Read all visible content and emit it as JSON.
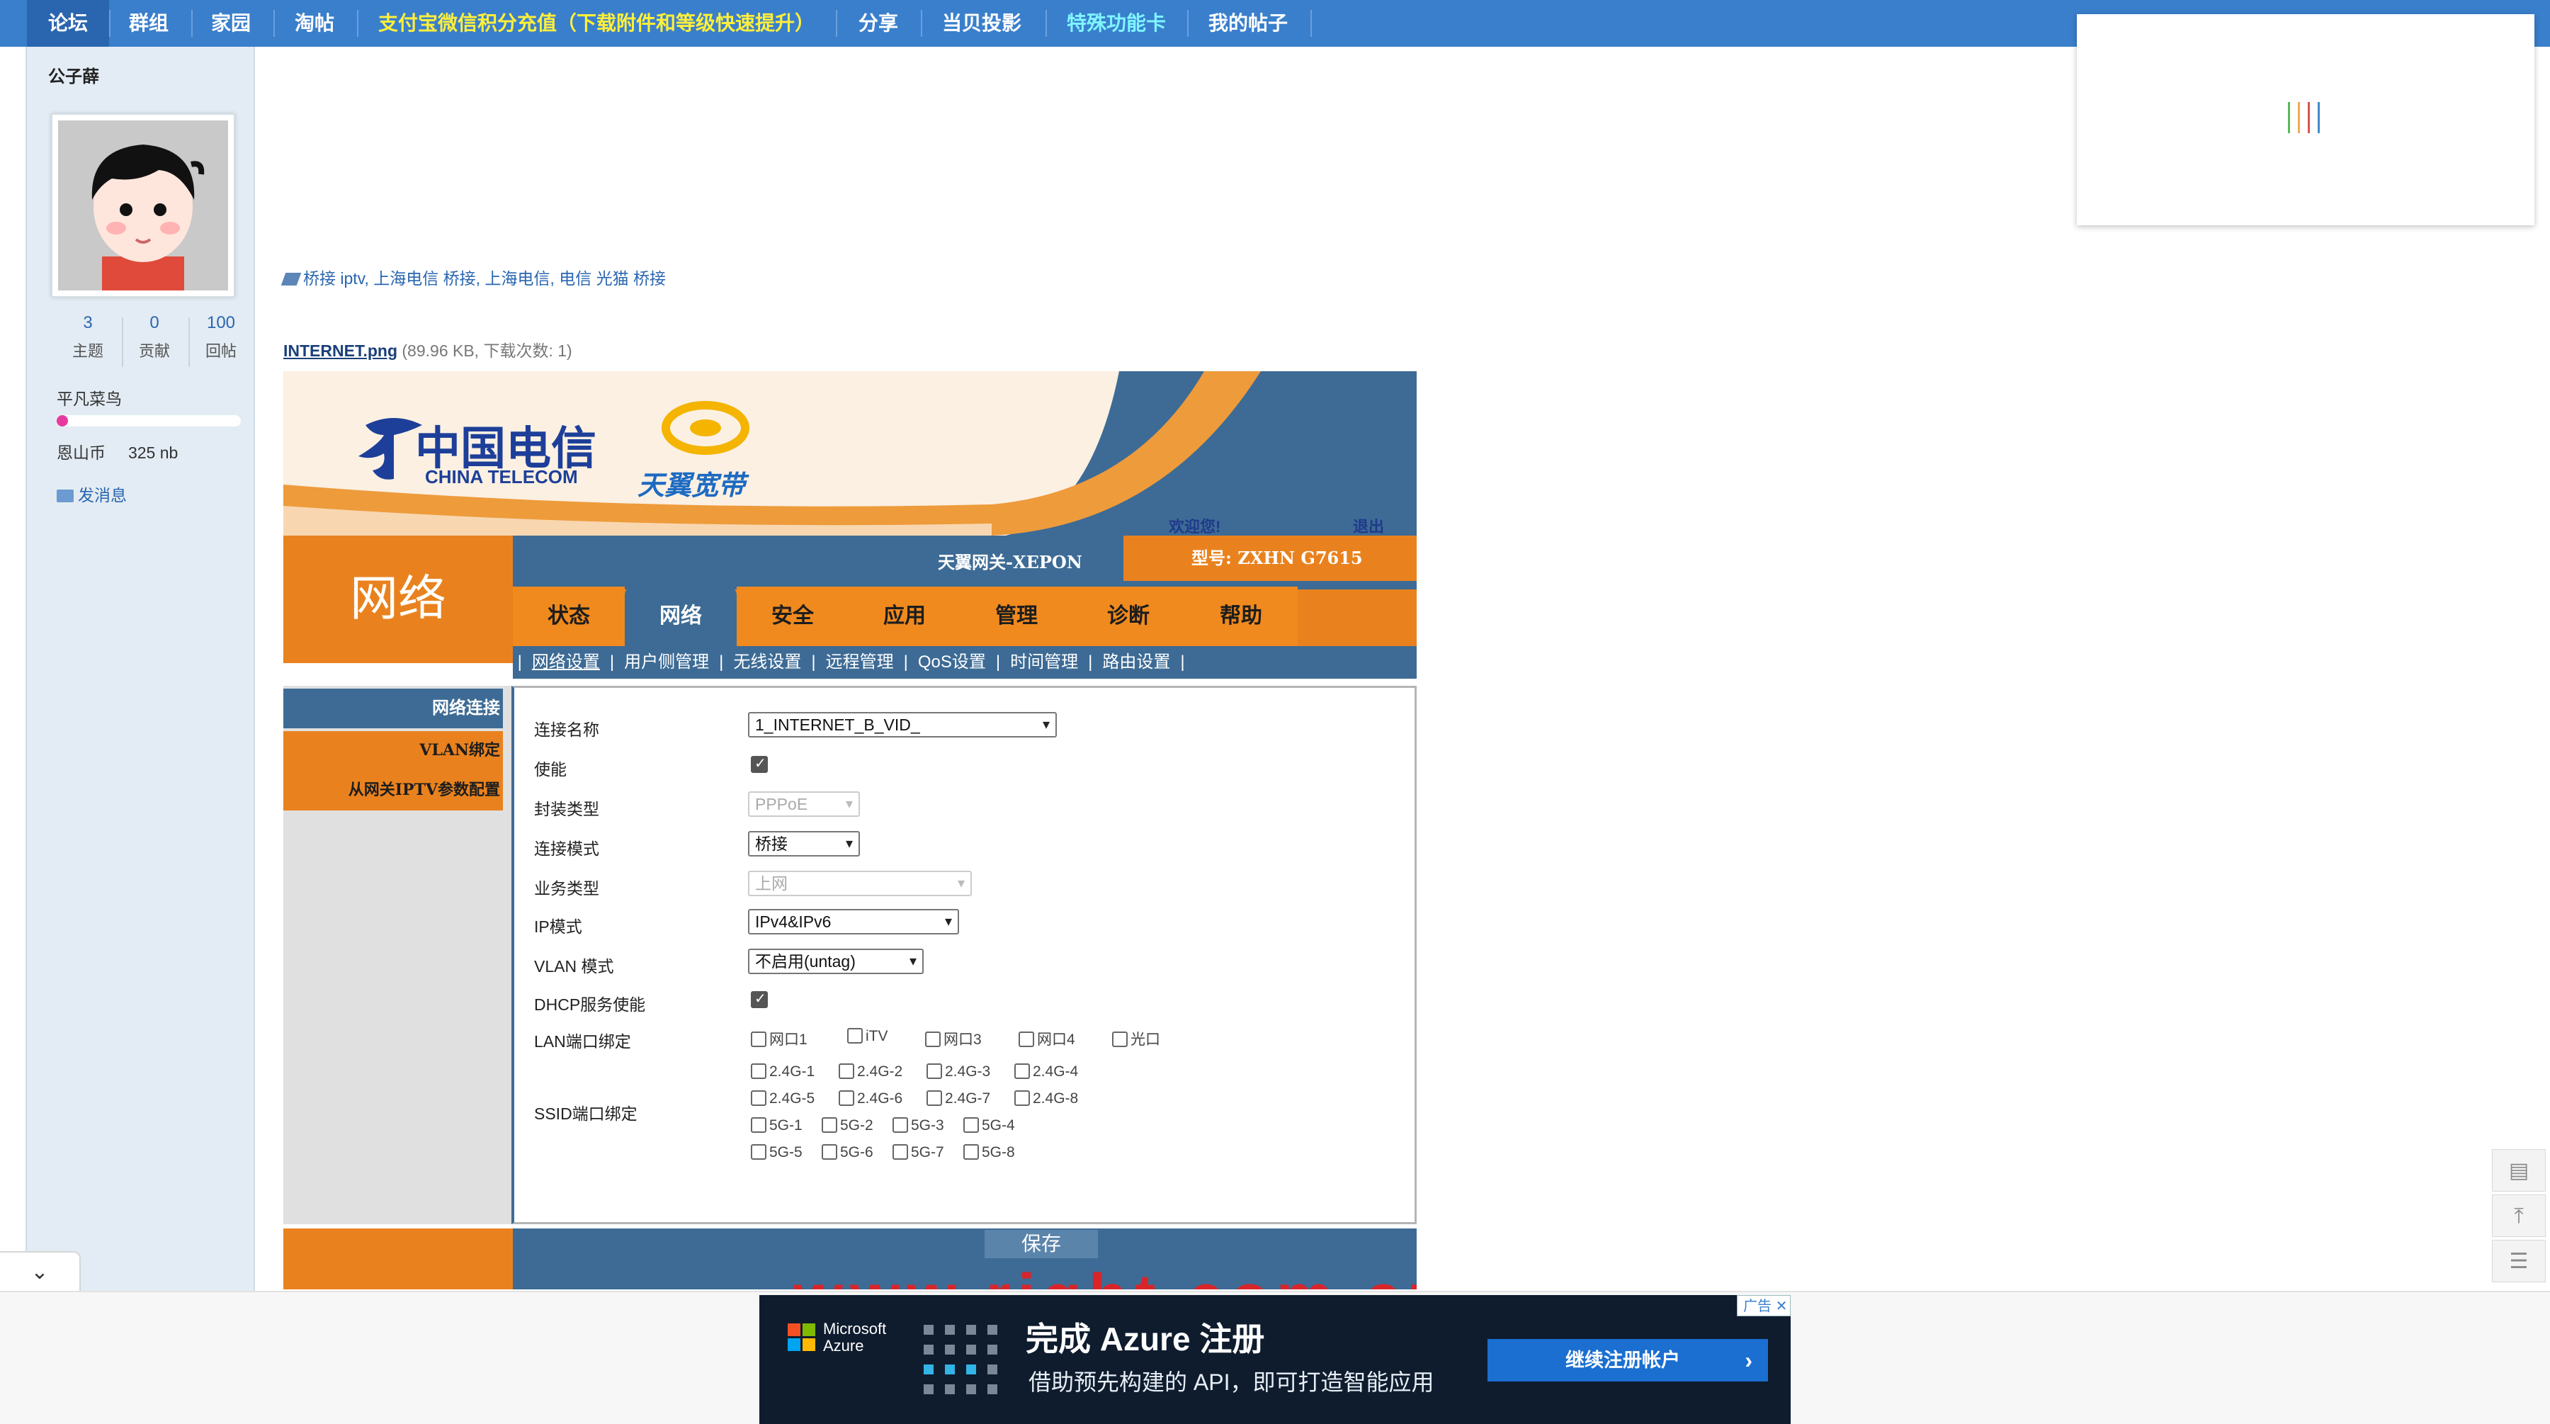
{
  "topnav": {
    "items": [
      "论坛",
      "群组",
      "家园",
      "淘帖",
      "支付宝微信积分充值（下载附件和等级快速提升）",
      "分享",
      "当贝投影",
      "特殊功能卡",
      "我的帖子"
    ]
  },
  "user": {
    "name": "公子薛",
    "stats": [
      {
        "value": "3",
        "label": "主题"
      },
      {
        "value": "0",
        "label": "贡献"
      },
      {
        "value": "100",
        "label": "回帖"
      }
    ],
    "rank": "平凡菜鸟",
    "rank_progress": 0.04,
    "coin_label": "恩山币",
    "coin_value": "325 nb",
    "message_label": "发消息"
  },
  "tags": {
    "items": [
      "桥接 iptv",
      "上海电信 桥接",
      "上海电信",
      "电信 光猫 桥接"
    ]
  },
  "attachment": {
    "name": "INTERNET.png",
    "meta": "(89.96 KB, 下载次数: 1)"
  },
  "router": {
    "brand": "中国电信",
    "brand_en": "CHINA TELECOM",
    "brand2": "天翼宽带",
    "welcome": "欢迎您!",
    "logout": "退出",
    "gateway": "天翼网关-XEPON",
    "model": "型号: ZXHN G7615",
    "page_title": "网络",
    "tabs": [
      "状态",
      "网络",
      "安全",
      "应用",
      "管理",
      "诊断",
      "帮助"
    ],
    "subnav": [
      "网络设置",
      "用户侧管理",
      "无线设置",
      "远程管理",
      "QoS设置",
      "时间管理",
      "路由设置"
    ],
    "left_menu": [
      "网络连接",
      "VLAN绑定",
      "从网关IPTV参数配置"
    ],
    "form": {
      "conn_name_label": "连接名称",
      "conn_name_value": "1_INTERNET_B_VID_",
      "enable_label": "使能",
      "encap_label": "封装类型",
      "encap_value": "PPPoE",
      "mode_label": "连接模式",
      "mode_value": "桥接",
      "service_label": "业务类型",
      "service_value": "上网",
      "ipmode_label": "IP模式",
      "ipmode_value": "IPv4&IPv6",
      "vlan_label": "VLAN 模式",
      "vlan_value": "不启用(untag)",
      "dhcp_label": "DHCP服务使能",
      "lan_label": "LAN端口绑定",
      "lan_ports": [
        "网口1",
        "iTV",
        "网口3",
        "网口4",
        "光口"
      ],
      "ssid_label": "SSID端口绑定",
      "ssid_24": [
        "2.4G-1",
        "2.4G-2",
        "2.4G-3",
        "2.4G-4",
        "2.4G-5",
        "2.4G-6",
        "2.4G-7",
        "2.4G-8"
      ],
      "ssid_5": [
        "5G-1",
        "5G-2",
        "5G-3",
        "5G-4",
        "5G-5",
        "5G-6",
        "5G-7",
        "5G-8"
      ]
    },
    "save_label": "保存",
    "watermark": "www.right.com.cn"
  },
  "ad": {
    "tag": "广告",
    "brand": "Microsoft Azure",
    "title": "完成 Azure 注册",
    "subtitle": "借助预先构建的 API，即可打造智能应用",
    "cta": "继续注册帐户"
  },
  "colors": {
    "nav_blue": "#3a7fcc",
    "telecom_orange": "#e9821e",
    "telecom_blue": "#3d6b95",
    "ad_bg": "#0e1c2e"
  }
}
